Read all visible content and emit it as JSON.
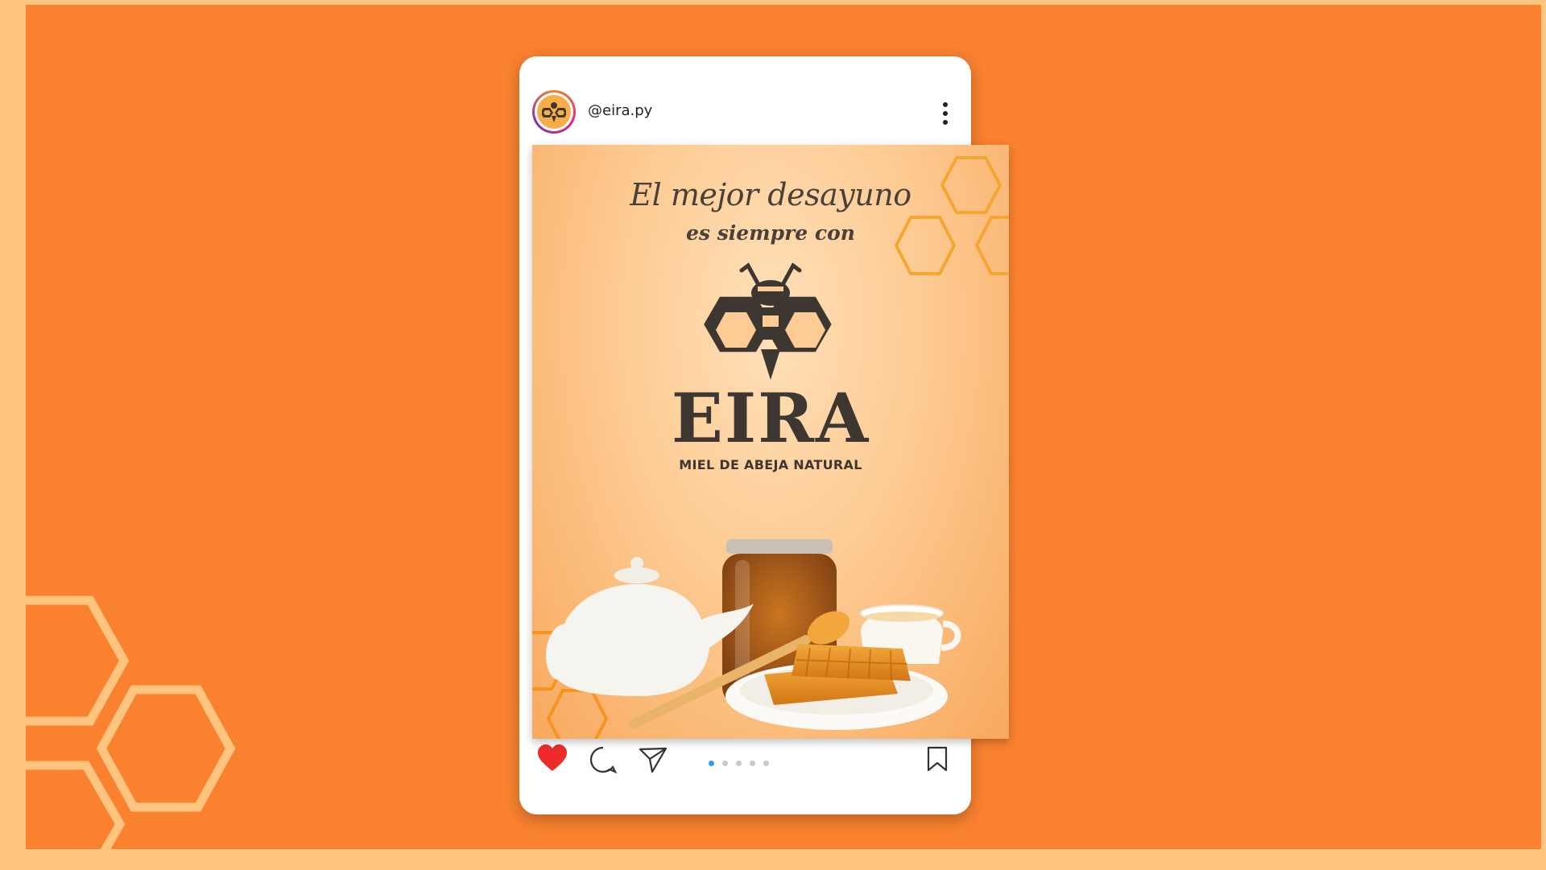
{
  "post": {
    "username": "@eira.py",
    "carousel": {
      "total": 5,
      "active_index": 0
    }
  },
  "creative": {
    "headline": "El mejor desayuno",
    "subline": "es siempre con",
    "brand": "EIRA",
    "tagline": "MIEL DE ABEJA NATURAL"
  },
  "actions": {
    "like_icon": "heart-icon",
    "comment_icon": "comment-icon",
    "share_icon": "send-icon",
    "save_icon": "bookmark-icon",
    "more_icon": "more-vertical-icon"
  },
  "colors": {
    "background": "#F98130",
    "frame": "#FFC57F",
    "like": "#ED2B2B",
    "carousel_active": "#3897F0",
    "brand_text": "#3E3631"
  }
}
